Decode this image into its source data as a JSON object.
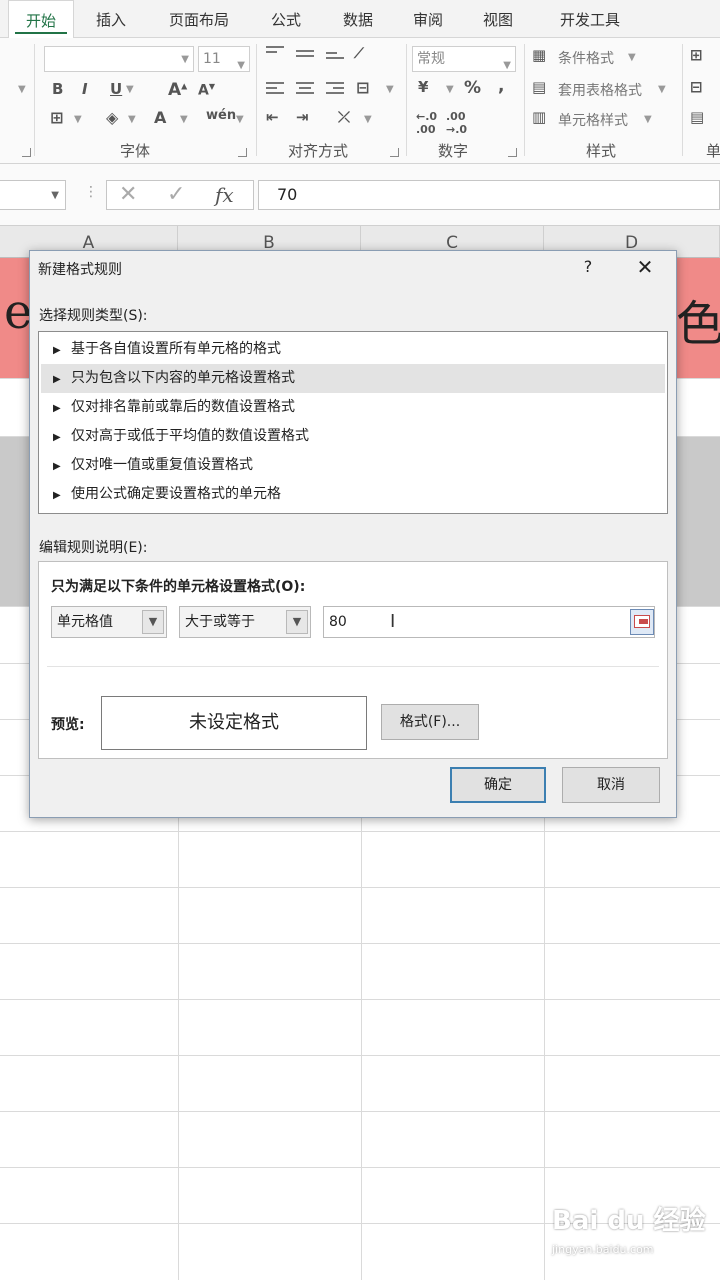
{
  "ribbon": {
    "tabs": [
      "开始",
      "插入",
      "页面布局",
      "公式",
      "数据",
      "审阅",
      "视图",
      "开发工具"
    ],
    "font_size": "11",
    "number_format": "常规",
    "groups": {
      "font": "字体",
      "alignment": "对齐方式",
      "number": "数字",
      "styles": "样式",
      "cells_partial": "单"
    },
    "style_buttons": [
      "条件格式",
      "套用表格格式",
      "单元格样式"
    ],
    "font_buttons": {
      "bold": "B",
      "italic": "I",
      "underline": "U",
      "font_color": "A",
      "phonetic": "wén"
    },
    "number_buttons": {
      "percent": "%",
      "comma": ","
    }
  },
  "formula_bar": {
    "value": "70",
    "fx": "fx",
    "cancel": "✕",
    "enter": "✓"
  },
  "sheet": {
    "columns": [
      "A",
      "B",
      "C",
      "D"
    ],
    "red_row_text_left": "e",
    "red_row_text_right": "色"
  },
  "dialog": {
    "title": "新建格式规则",
    "help": "?",
    "close": "✕",
    "select_label": "选择规则类型(S):",
    "rule_types": [
      "基于各自值设置所有单元格的格式",
      "只为包含以下内容的单元格设置格式",
      "仅对排名靠前或靠后的数值设置格式",
      "仅对高于或低于平均值的数值设置格式",
      "仅对唯一值或重复值设置格式",
      "使用公式确定要设置格式的单元格"
    ],
    "selected_rule_index": 1,
    "edit_label": "编辑规则说明(E):",
    "edit_sublabel": "只为满足以下条件的单元格设置格式(O):",
    "condition_type": "单元格值",
    "operator": "大于或等于",
    "value": "80",
    "preview_label": "预览:",
    "preview_text": "未设定格式",
    "format_button": "格式(F)...",
    "ok_button": "确定",
    "cancel_button": "取消"
  },
  "watermark": {
    "brand": "Bai du 经验",
    "url": "jingyan.baidu.com"
  }
}
